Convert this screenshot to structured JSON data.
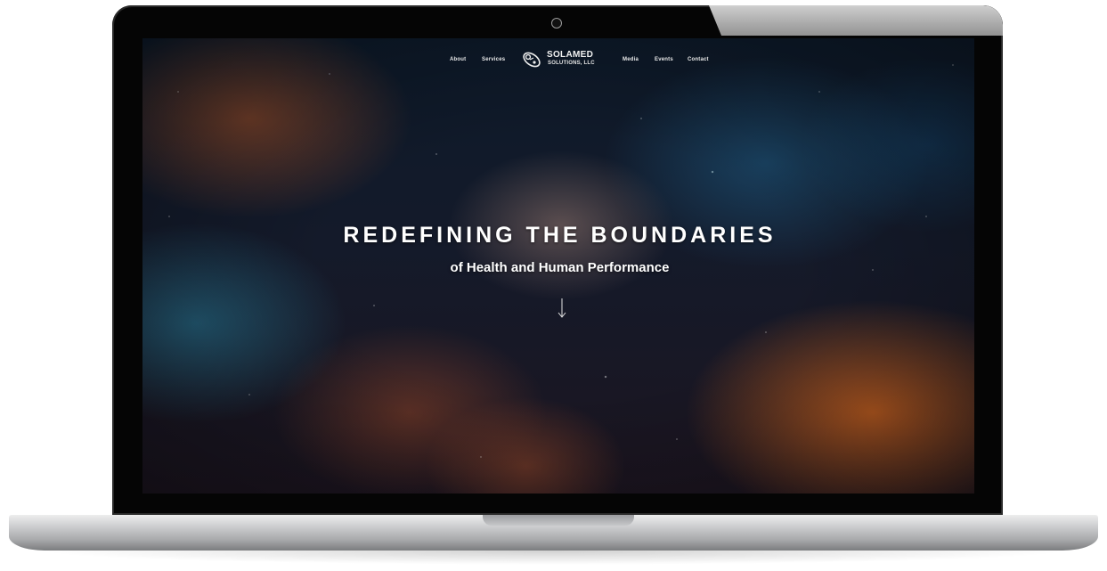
{
  "nav": {
    "items": [
      "About",
      "Services",
      "Media",
      "Events",
      "Contact"
    ]
  },
  "logo": {
    "name": "SOLAMED",
    "subtitle": "SOLUTIONS, LLC"
  },
  "hero": {
    "title": "REDEFINING THE BOUNDARIES",
    "subtitle": "of Health and Human Performance",
    "scroll_icon": "arrow-down-icon"
  },
  "colors": {
    "text": "#ffffff",
    "bezel": "#050505",
    "nebula_orange": "#e86e1e",
    "nebula_teal": "#2878a0"
  }
}
